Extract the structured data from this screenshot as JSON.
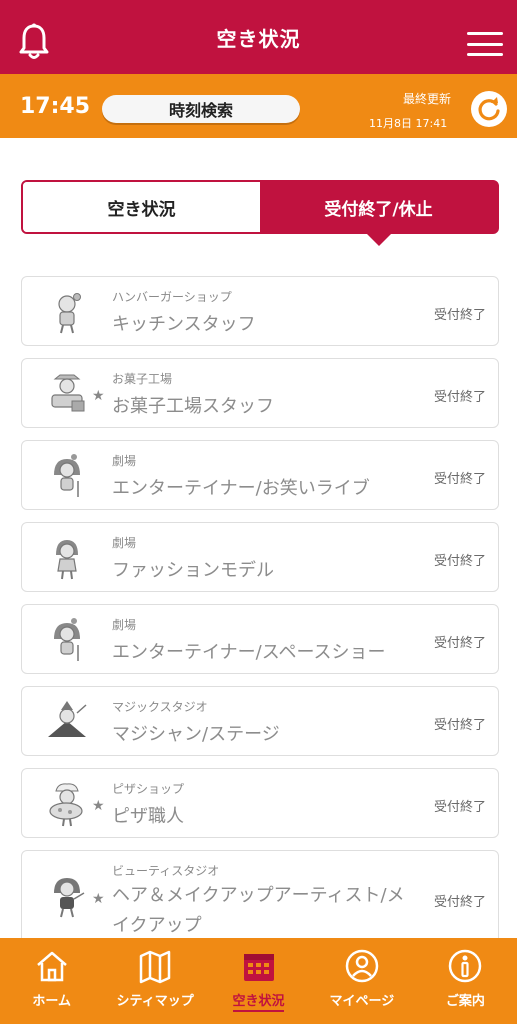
{
  "header": {
    "title": "空き状況",
    "bell_icon": "bell-icon",
    "menu_icon": "hamburger-menu-icon"
  },
  "timebar": {
    "current_time": "17:45",
    "time_search_label": "時刻検索",
    "last_updated_label": "最終更新",
    "last_updated_time": "11月8日 17:41"
  },
  "tabs": [
    {
      "label": "空き状況",
      "active": false
    },
    {
      "label": "受付終了/休止",
      "active": true
    }
  ],
  "items": [
    {
      "category": "ハンバーガーショップ",
      "name": "キッチンスタッフ",
      "status": "受付終了",
      "star": false
    },
    {
      "category": "お菓子工場",
      "name": "お菓子工場スタッフ",
      "status": "受付終了",
      "star": true
    },
    {
      "category": "劇場",
      "name": "エンターテイナー/お笑いライブ",
      "status": "受付終了",
      "star": false
    },
    {
      "category": "劇場",
      "name": "ファッションモデル",
      "status": "受付終了",
      "star": false
    },
    {
      "category": "劇場",
      "name": "エンターテイナー/スペースショー",
      "status": "受付終了",
      "star": false
    },
    {
      "category": "マジックスタジオ",
      "name": "マジシャン/ステージ",
      "status": "受付終了",
      "star": false
    },
    {
      "category": "ピザショップ",
      "name": "ピザ職人",
      "status": "受付終了",
      "star": true
    },
    {
      "category": "ビューティスタジオ",
      "name": "ヘア＆メイクアップアーティスト/メイクアップ",
      "status": "受付終了",
      "star": true
    }
  ],
  "bottom_nav": [
    {
      "label": "ホーム",
      "icon": "home-icon",
      "active": false
    },
    {
      "label": "シティマップ",
      "icon": "map-icon",
      "active": false
    },
    {
      "label": "空き状況",
      "icon": "calendar-icon",
      "active": true
    },
    {
      "label": "マイページ",
      "icon": "user-icon",
      "active": false
    },
    {
      "label": "ご案内",
      "icon": "info-icon",
      "active": false
    }
  ],
  "colors": {
    "primary": "#c0123f",
    "accent": "#f08a14",
    "muted_text": "#8c8c8c"
  }
}
